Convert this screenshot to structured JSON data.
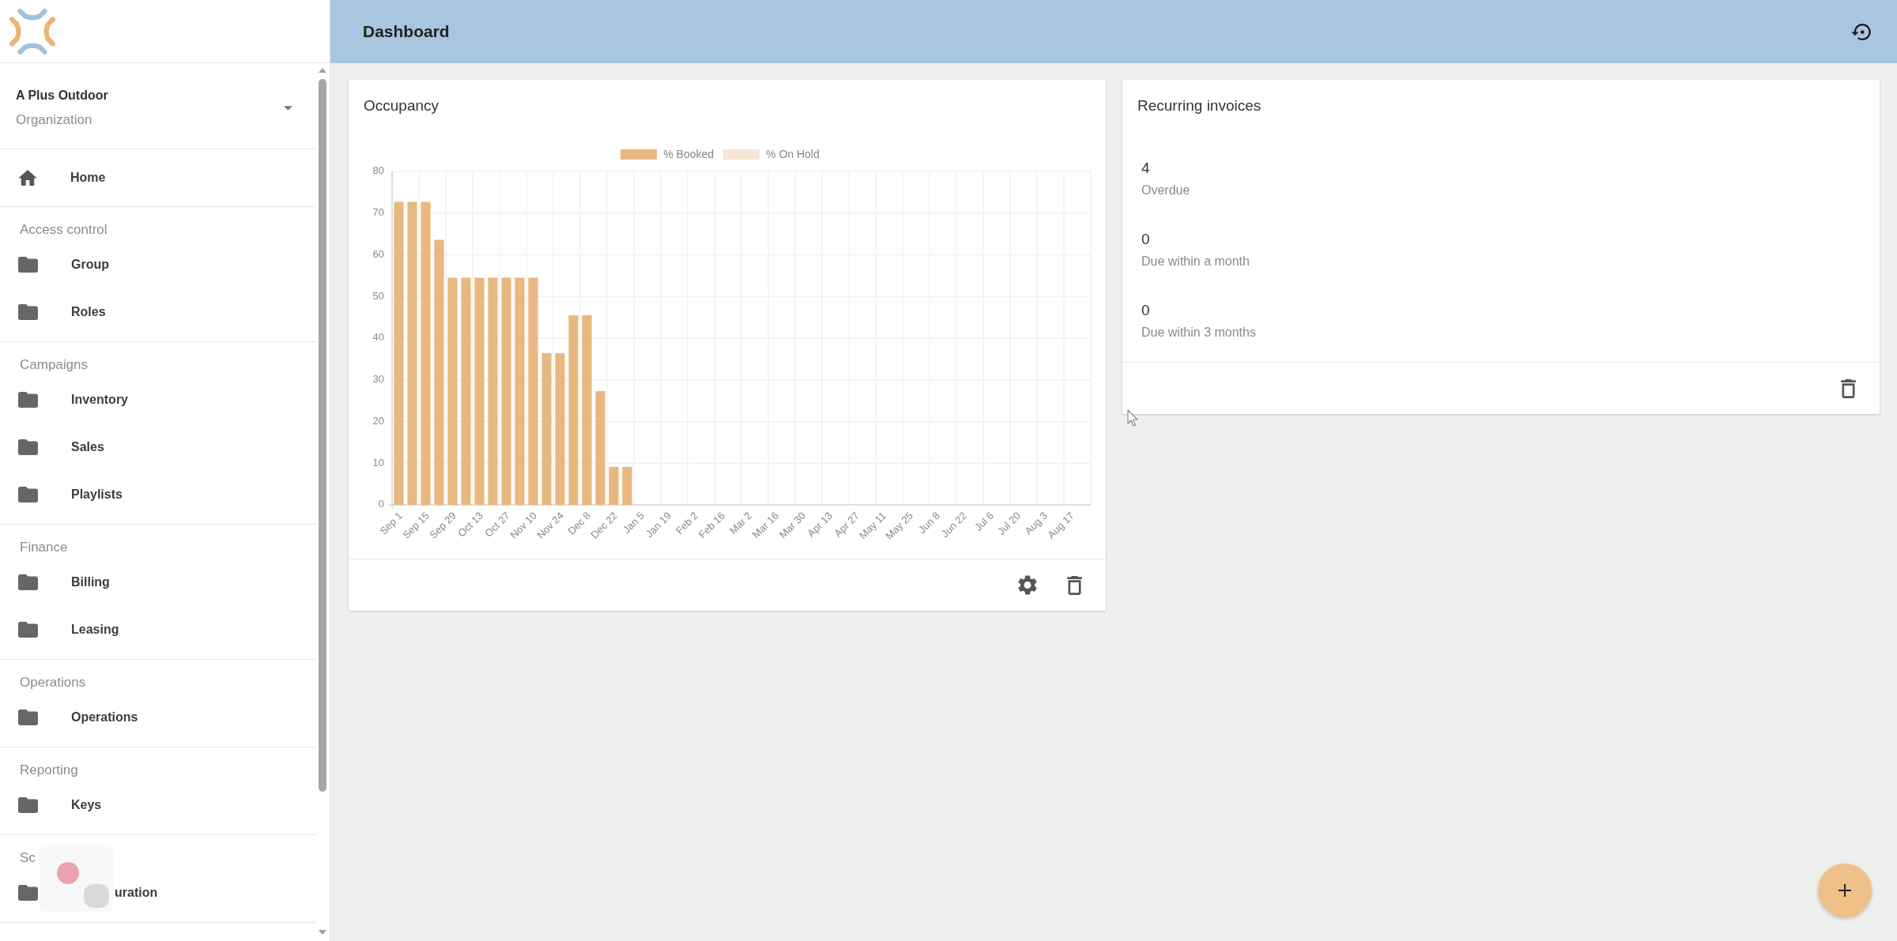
{
  "sidebar": {
    "organization": {
      "name": "A Plus Outdoor",
      "label": "Organization"
    },
    "sections": [
      {
        "items": [
          {
            "label": "Home",
            "kind": "home",
            "selected": false
          }
        ]
      },
      {
        "title": "Access control",
        "items": [
          {
            "label": "Group",
            "kind": "folder",
            "selected": false
          },
          {
            "label": "Roles",
            "kind": "folder",
            "selected": false
          }
        ]
      },
      {
        "title": "Campaigns",
        "items": [
          {
            "label": "Inventory",
            "kind": "folder",
            "selected": false
          },
          {
            "label": "Sales",
            "kind": "folder",
            "selected": false
          },
          {
            "label": "Playlists",
            "kind": "folder",
            "selected": false
          }
        ]
      },
      {
        "title": "Finance",
        "items": [
          {
            "label": "Billing",
            "kind": "folder",
            "selected": false
          },
          {
            "label": "Leasing",
            "kind": "folder",
            "selected": false
          }
        ]
      },
      {
        "title": "Operations",
        "items": [
          {
            "label": "Operations",
            "kind": "folder",
            "selected": false
          }
        ]
      },
      {
        "title": "Reporting",
        "items": [
          {
            "label": "Keys",
            "kind": "folder",
            "selected": false
          }
        ]
      },
      {
        "title": "Sc",
        "items": [
          {
            "label": "uration",
            "kind": "folder",
            "selected": false
          }
        ]
      }
    ]
  },
  "header": {
    "title": "Dashboard"
  },
  "occupancy": {
    "title": "Occupancy",
    "chart_data": {
      "type": "bar",
      "grid": true,
      "categories": [
        "Sep 1",
        null,
        "Sep 15",
        null,
        "Sep 29",
        null,
        "Oct 13",
        null,
        "Oct 27",
        null,
        "Nov 10",
        null,
        "Nov 24",
        null,
        "Dec 8",
        null,
        "Dec 22",
        null,
        "Jan 5",
        null,
        "Jan 19",
        null,
        "Feb 2",
        null,
        "Feb 16",
        null,
        "Mar 2",
        null,
        "Mar 16",
        null,
        "Mar 30",
        null,
        "Apr 13",
        null,
        "Apr 27",
        null,
        "May 11",
        null,
        "May 25",
        null,
        "Jun 8",
        null,
        "Jun 22",
        null,
        "Jul 6",
        null,
        "Jul 20",
        null,
        "Aug 3",
        null,
        "Aug 17",
        null
      ],
      "series": [
        {
          "name": "% Booked",
          "color": "#e8b880",
          "values": [
            72.7,
            72.7,
            72.7,
            63.6,
            54.5,
            54.5,
            54.5,
            54.5,
            54.5,
            54.5,
            54.5,
            36.4,
            36.4,
            45.5,
            45.5,
            27.3,
            9.1,
            9.1,
            null,
            null,
            null,
            null,
            null,
            null,
            null,
            null,
            null,
            null,
            null,
            null,
            null,
            null,
            null,
            null,
            null,
            null,
            null,
            null,
            null,
            null,
            null,
            null,
            null,
            null,
            null,
            null,
            null,
            null,
            null,
            null,
            null,
            null
          ]
        },
        {
          "name": "% On Hold",
          "color": "#f5e6d6",
          "values": [
            0,
            0,
            0,
            0,
            0,
            0,
            0,
            0,
            0,
            0,
            0,
            0,
            0,
            0,
            0,
            0,
            0,
            0,
            null,
            null,
            null,
            null,
            null,
            null,
            null,
            null,
            null,
            null,
            null,
            null,
            null,
            null,
            null,
            null,
            null,
            null,
            null,
            null,
            null,
            null,
            null,
            null,
            null,
            null,
            null,
            null,
            null,
            null,
            null,
            null,
            null,
            null
          ]
        }
      ],
      "ylim": [
        0,
        80
      ],
      "yticks": [
        0,
        10,
        20,
        30,
        40,
        50,
        60,
        70,
        80
      ]
    }
  },
  "recurring_invoices": {
    "title": "Recurring invoices",
    "stats": [
      {
        "value": "4",
        "label": "Overdue"
      },
      {
        "value": "0",
        "label": "Due within a month"
      },
      {
        "value": "0",
        "label": "Due within 3 months"
      }
    ]
  }
}
